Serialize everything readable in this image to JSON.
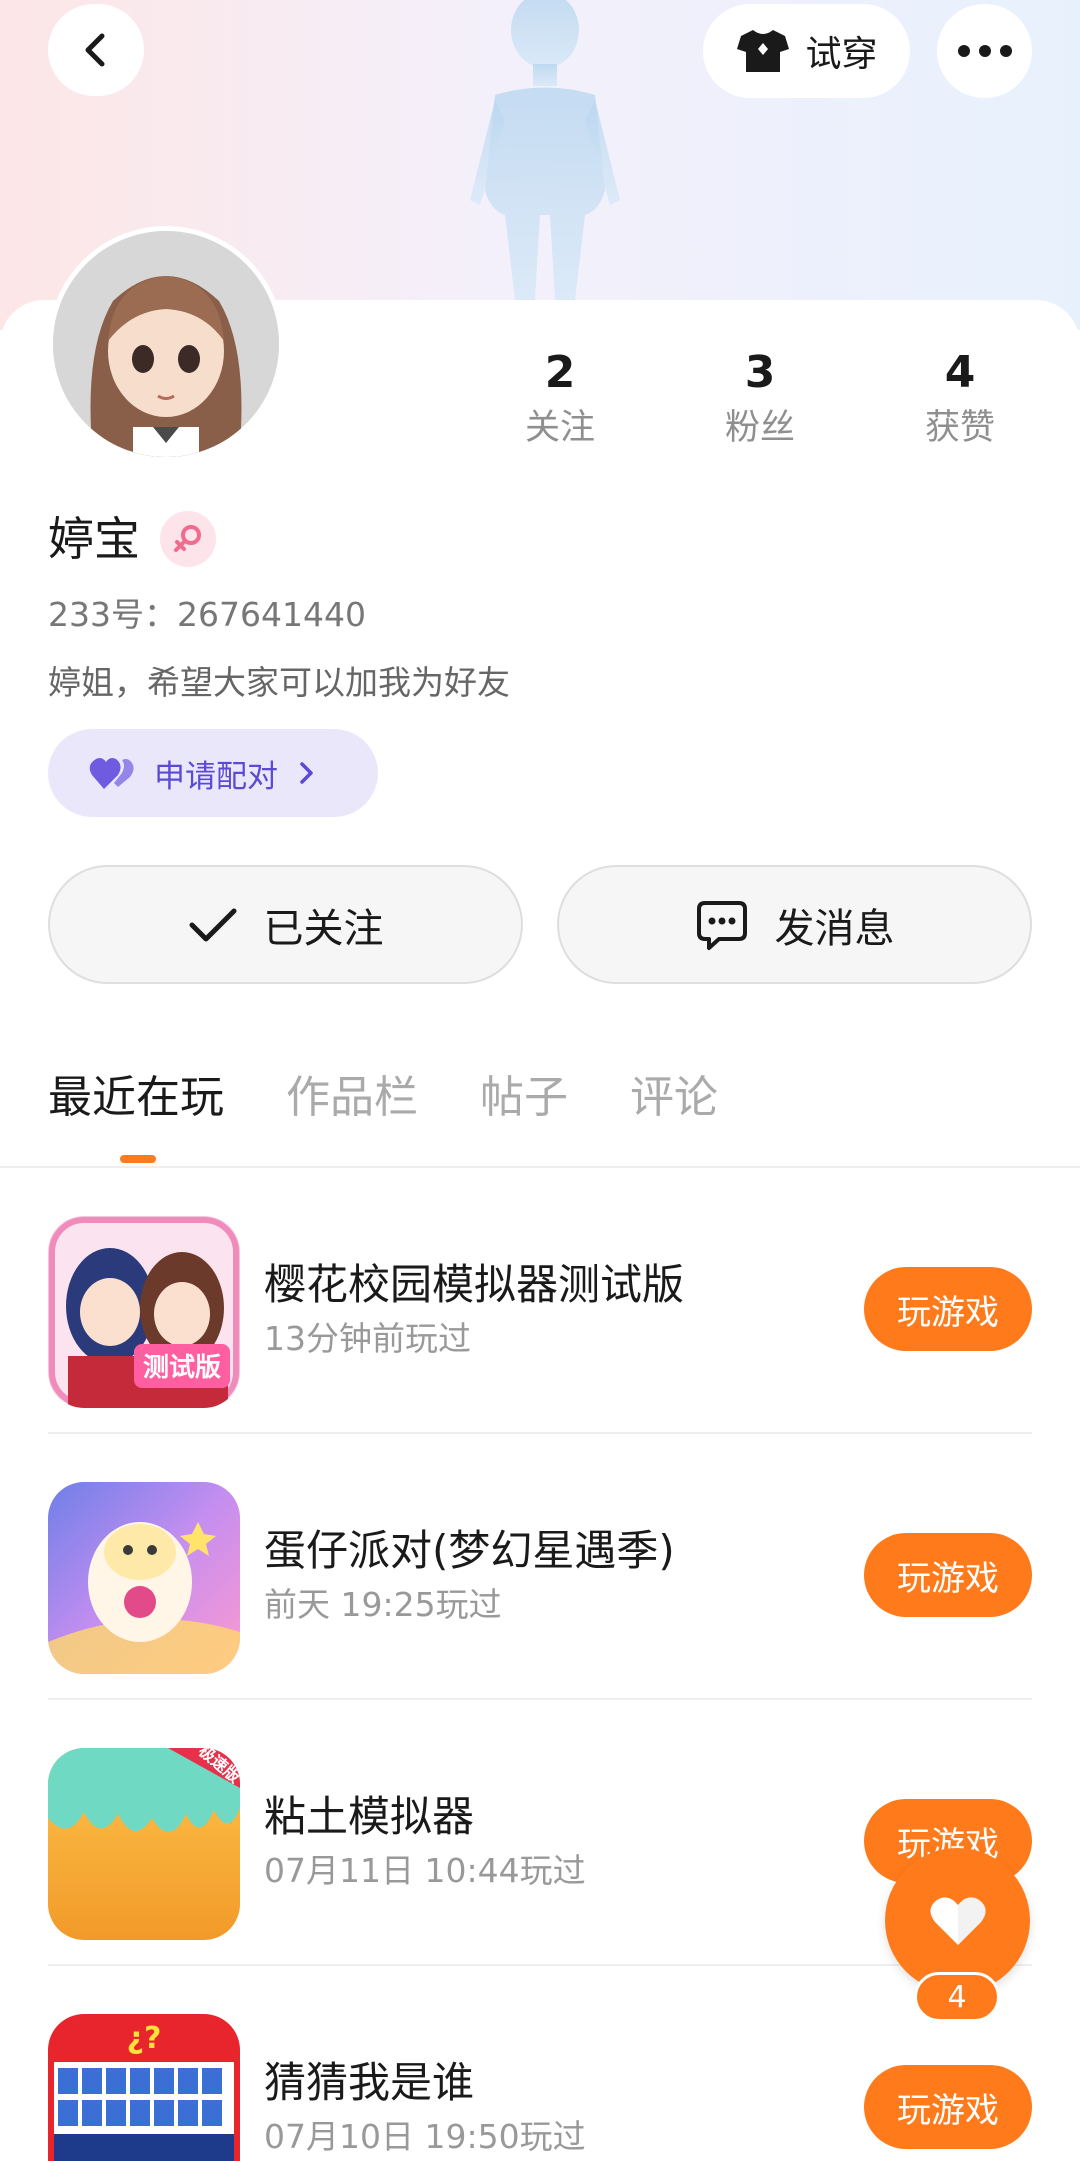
{
  "header": {
    "try_on_label": "试穿",
    "icons": {
      "back": "chevron-left-icon",
      "try_on": "shirt-icon",
      "more": "more-dots-icon"
    }
  },
  "profile": {
    "name": "婷宝",
    "gender": "female",
    "uid": "233号：267641440",
    "bio": "婷姐，希望大家可以加我为好友",
    "pair_label": "申请配对",
    "stats": [
      {
        "value": "2",
        "label": "关注"
      },
      {
        "value": "3",
        "label": "粉丝"
      },
      {
        "value": "4",
        "label": "获赞"
      }
    ]
  },
  "actions": {
    "followed_label": "已关注",
    "message_label": "发消息"
  },
  "tabs": [
    {
      "label": "最近在玩",
      "active": true
    },
    {
      "label": "作品栏",
      "active": false
    },
    {
      "label": "帖子",
      "active": false
    },
    {
      "label": "评论",
      "active": false
    }
  ],
  "games": [
    {
      "title": "樱花校园模拟器测试版",
      "subtitle": "13分钟前玩过",
      "button": "玩游戏",
      "icon_badge": "测试版"
    },
    {
      "title": "蛋仔派对(梦幻星遇季)",
      "subtitle": "前天 19:25玩过",
      "button": "玩游戏"
    },
    {
      "title": "粘土模拟器",
      "subtitle": "07月11日 10:44玩过",
      "button": "玩游戏",
      "icon_badge": "极速版"
    },
    {
      "title": "猜猜我是谁",
      "subtitle": "07月10日 19:50玩过",
      "button": "玩游戏"
    }
  ],
  "like_fab": {
    "count": "4",
    "icon": "heart-icon"
  },
  "colors": {
    "accent": "#ff7a1a",
    "pair_bg": "#ebe7fb",
    "pair_text": "#5a4ad6"
  }
}
